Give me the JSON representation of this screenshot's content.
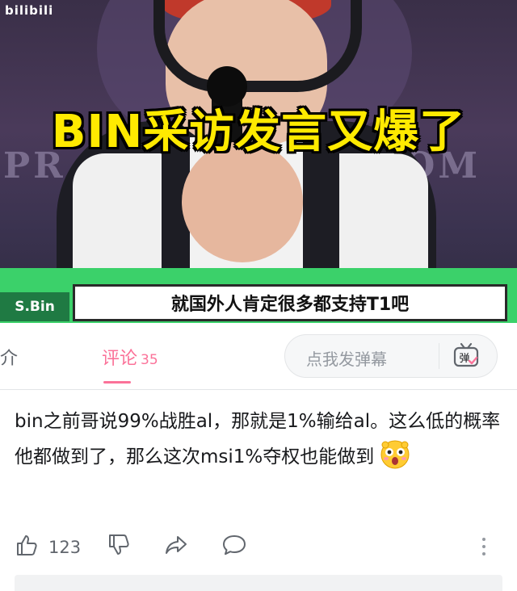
{
  "video": {
    "logo": "bilibili",
    "headline": "BIN采访发言又爆了",
    "name_tag": "S.Bin",
    "caption": "就国外人肯定很多都支持T1吧",
    "background_text_1": "PR",
    "background_text_2": "OM"
  },
  "tabs": {
    "intro_label": "介",
    "comments_label": "评论",
    "comments_count": "35",
    "danmaku_placeholder": "点我发弹幕",
    "danmaku_icon_label": "弹"
  },
  "comment": {
    "text": "bin之前哥说99%战胜al，那就是1%输给al。这么低的概率他都做到了，那么这次msi1%夺权也能做到",
    "emoji": "astonished-face-emoji"
  },
  "actions": {
    "like_count": "123",
    "icons": [
      "thumbs-up-icon",
      "thumbs-down-icon",
      "share-icon",
      "reply-icon",
      "more-vertical-icon"
    ]
  },
  "colors": {
    "accent": "#fb7299",
    "headline_yellow": "#ffea00",
    "caption_green": "#3bd16a",
    "text_gray": "#61666d"
  }
}
